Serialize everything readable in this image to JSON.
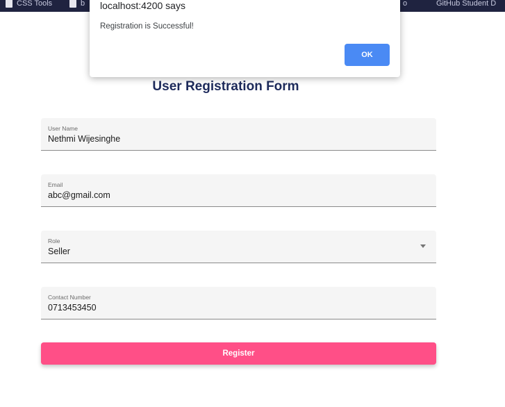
{
  "bookmarks_bar": {
    "items": [
      "CSS Tools",
      "b",
      "o",
      "GitHub Student D"
    ]
  },
  "form": {
    "title": "User Registration Form",
    "fields": [
      {
        "label": "User Name",
        "value": "Nethmi Wijesinghe"
      },
      {
        "label": "Email",
        "value": "abc@gmail.com"
      },
      {
        "label": "Role",
        "value": "Seller"
      },
      {
        "label": "Contact Number",
        "value": "0713453450"
      }
    ],
    "register_label": "Register"
  },
  "alert": {
    "title": "localhost:4200 says",
    "message": "Registration is Successful!",
    "ok_label": "OK"
  },
  "colors": {
    "bookmarks_bar_bg": "#1f2340",
    "title_text": "#1d2a5b",
    "register_button": "#ff4f87",
    "ok_button": "#4a8af4"
  }
}
